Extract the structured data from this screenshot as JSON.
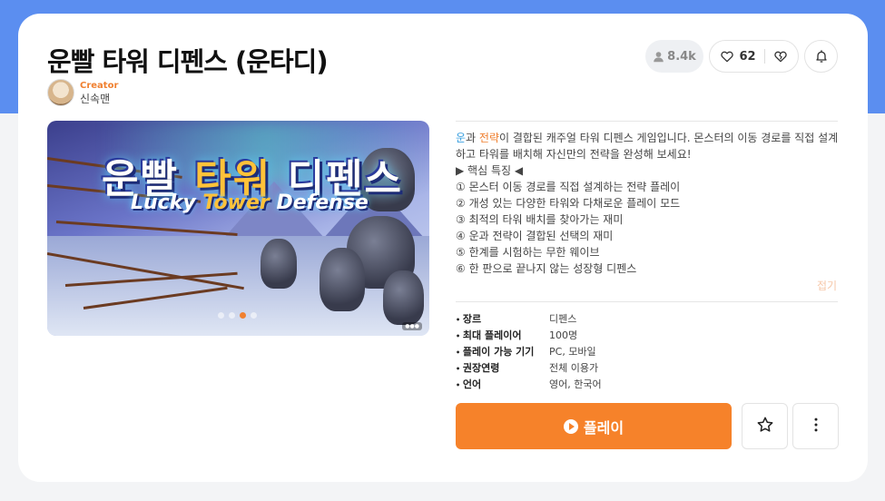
{
  "game": {
    "title": "운빨 타워 디펜스 (운타디)",
    "creator_role": "Creator",
    "creator_name": "신속맨"
  },
  "stats": {
    "views": "8.4k",
    "likes": "62"
  },
  "banner": {
    "logo_kr_1": "운빨",
    "logo_kr_2": "타워",
    "logo_kr_3": "디펜스",
    "logo_en_1": "Lucky",
    "logo_en_2": "Tower",
    "logo_en_3": "Defense",
    "slide_count": 4,
    "active_slide": 3
  },
  "description": {
    "word_luck": "운",
    "word_and": "과 ",
    "word_strategy": "전략",
    "line_intro": "이 결합된 캐주얼 타워 디펜스 게임입니다. 몬스터의 이동 경로를 직접 설계하고 타워를 배치해 자신만의 전략을 완성해 보세요!",
    "features_title": "▶ 핵심 특징 ◀",
    "features": [
      "① 몬스터 이동 경로를 직접 설계하는 전략 플레이",
      "② 개성 있는 다양한 타워와 다채로운 플레이 모드",
      "③ 최적의 타워 배치를 찾아가는 재미",
      "④ 운과 전략이 결합된 선택의 재미",
      "⑤ 한계를 시험하는 무한 웨이브",
      "⑥ 한 판으로 끝나지 않는 성장형 디펜스"
    ],
    "fold_label": "접기"
  },
  "info": [
    {
      "key": "장르",
      "value": "디펜스"
    },
    {
      "key": "최대 플레이어",
      "value": "100명"
    },
    {
      "key": "플레이 가능 기기",
      "value": "PC, 모바일"
    },
    {
      "key": "권장연령",
      "value": "전체 이용가"
    },
    {
      "key": "언어",
      "value": "영어, 한국어"
    }
  ],
  "actions": {
    "play_label": "플레이"
  },
  "colors": {
    "accent": "#f6822a",
    "header_band": "#5b8ef0"
  },
  "icons": [
    "user-icon",
    "heart-icon",
    "broken-heart-icon",
    "bell-icon",
    "play-icon",
    "star-icon",
    "more-vertical-icon"
  ]
}
